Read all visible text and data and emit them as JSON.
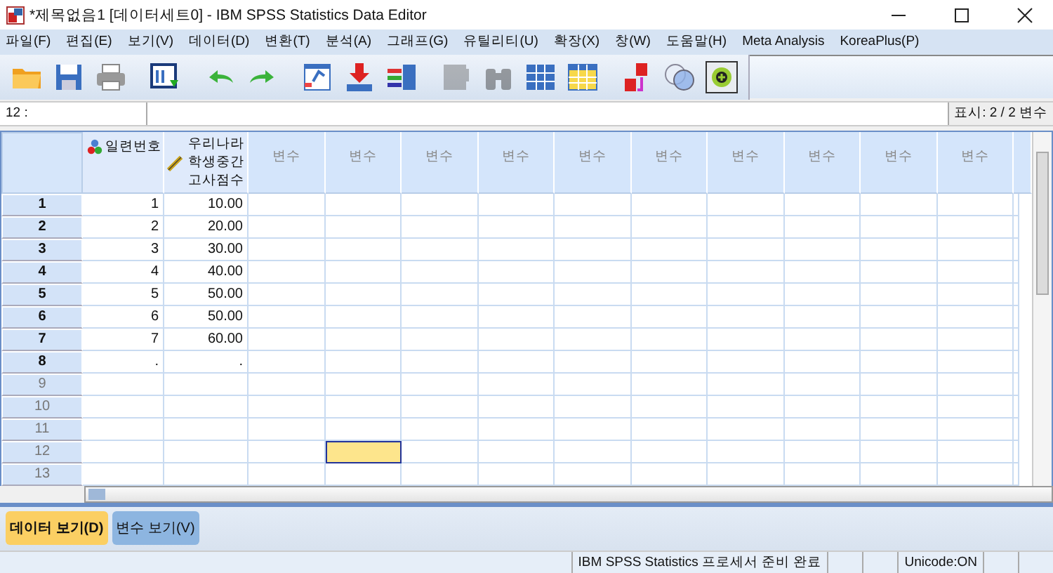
{
  "window": {
    "title": "*제목없음1 [데이터세트0] - IBM SPSS Statistics Data Editor"
  },
  "menu": [
    "파일(F)",
    "편집(E)",
    "보기(V)",
    "데이터(D)",
    "변환(T)",
    "분석(A)",
    "그래프(G)",
    "유틸리티(U)",
    "확장(X)",
    "창(W)",
    "도움말(H)",
    "Meta Analysis",
    "KoreaPlus(P)"
  ],
  "toolbar": [
    {
      "kind": "open",
      "disabled": false
    },
    {
      "kind": "save",
      "disabled": false
    },
    {
      "kind": "print",
      "disabled": false
    },
    {
      "kind": "recall",
      "disabled": false
    },
    {
      "kind": "undo",
      "disabled": false
    },
    {
      "kind": "redo",
      "disabled": false
    },
    {
      "kind": "goto-case",
      "disabled": false
    },
    {
      "kind": "goto-variable",
      "disabled": false
    },
    {
      "kind": "variables",
      "disabled": false
    },
    {
      "kind": "split",
      "disabled": true
    },
    {
      "kind": "find",
      "disabled": true
    },
    {
      "kind": "insert-cases",
      "disabled": false
    },
    {
      "kind": "table",
      "disabled": false
    },
    {
      "kind": "value-labels",
      "disabled": false
    },
    {
      "kind": "sets",
      "disabled": false
    },
    {
      "kind": "plus",
      "disabled": false
    }
  ],
  "cell_ref": "12 :",
  "visible_vars": "표시: 2 / 2 변수",
  "columns": [
    {
      "label": "일련번호",
      "kind": "nominal"
    },
    {
      "label": "우리나라 학생중간 고사점수",
      "kind": "scale"
    },
    {
      "label": "변수",
      "kind": "blank"
    },
    {
      "label": "변수",
      "kind": "blank"
    },
    {
      "label": "변수",
      "kind": "blank"
    },
    {
      "label": "변수",
      "kind": "blank"
    },
    {
      "label": "변수",
      "kind": "blank"
    },
    {
      "label": "변수",
      "kind": "blank"
    },
    {
      "label": "변수",
      "kind": "blank"
    },
    {
      "label": "변수",
      "kind": "blank"
    },
    {
      "label": "변수",
      "kind": "blank"
    },
    {
      "label": "변수",
      "kind": "blank"
    }
  ],
  "rows": [
    {
      "number": "1",
      "greyed": false,
      "cells": [
        {
          "value": "1",
          "selected": false
        },
        {
          "value": "10.00",
          "selected": false
        }
      ]
    },
    {
      "number": "2",
      "greyed": false,
      "cells": [
        {
          "value": "2",
          "selected": false
        },
        {
          "value": "20.00",
          "selected": false
        }
      ]
    },
    {
      "number": "3",
      "greyed": false,
      "cells": [
        {
          "value": "3",
          "selected": false
        },
        {
          "value": "30.00",
          "selected": false
        }
      ]
    },
    {
      "number": "4",
      "greyed": false,
      "cells": [
        {
          "value": "4",
          "selected": false
        },
        {
          "value": "40.00",
          "selected": false
        }
      ]
    },
    {
      "number": "5",
      "greyed": false,
      "cells": [
        {
          "value": "5",
          "selected": false
        },
        {
          "value": "50.00",
          "selected": false
        }
      ]
    },
    {
      "number": "6",
      "greyed": false,
      "cells": [
        {
          "value": "6",
          "selected": false
        },
        {
          "value": "50.00",
          "selected": false
        }
      ]
    },
    {
      "number": "7",
      "greyed": false,
      "cells": [
        {
          "value": "7",
          "selected": false
        },
        {
          "value": "60.00",
          "selected": false
        }
      ]
    },
    {
      "number": "8",
      "greyed": false,
      "cells": [
        {
          "value": ".",
          "selected": false
        },
        {
          "value": ".",
          "selected": false
        }
      ]
    },
    {
      "number": "9",
      "greyed": true,
      "cells": []
    },
    {
      "number": "10",
      "greyed": true,
      "cells": []
    },
    {
      "number": "11",
      "greyed": true,
      "cells": []
    },
    {
      "number": "12",
      "greyed": true,
      "cells": [
        {
          "selected": false
        },
        {
          "selected": false
        },
        {
          "selected": false
        },
        {
          "selected": true
        }
      ]
    },
    {
      "number": "13",
      "greyed": true,
      "cells": []
    }
  ],
  "tabs": [
    {
      "label": "데이터 보기(D)",
      "selected": true
    },
    {
      "label": "변수 보기(V)",
      "selected": false
    }
  ],
  "status_bar": {
    "message": "IBM SPSS Statistics 프로세서 준비 완료",
    "encoding": "Unicode:ON"
  }
}
